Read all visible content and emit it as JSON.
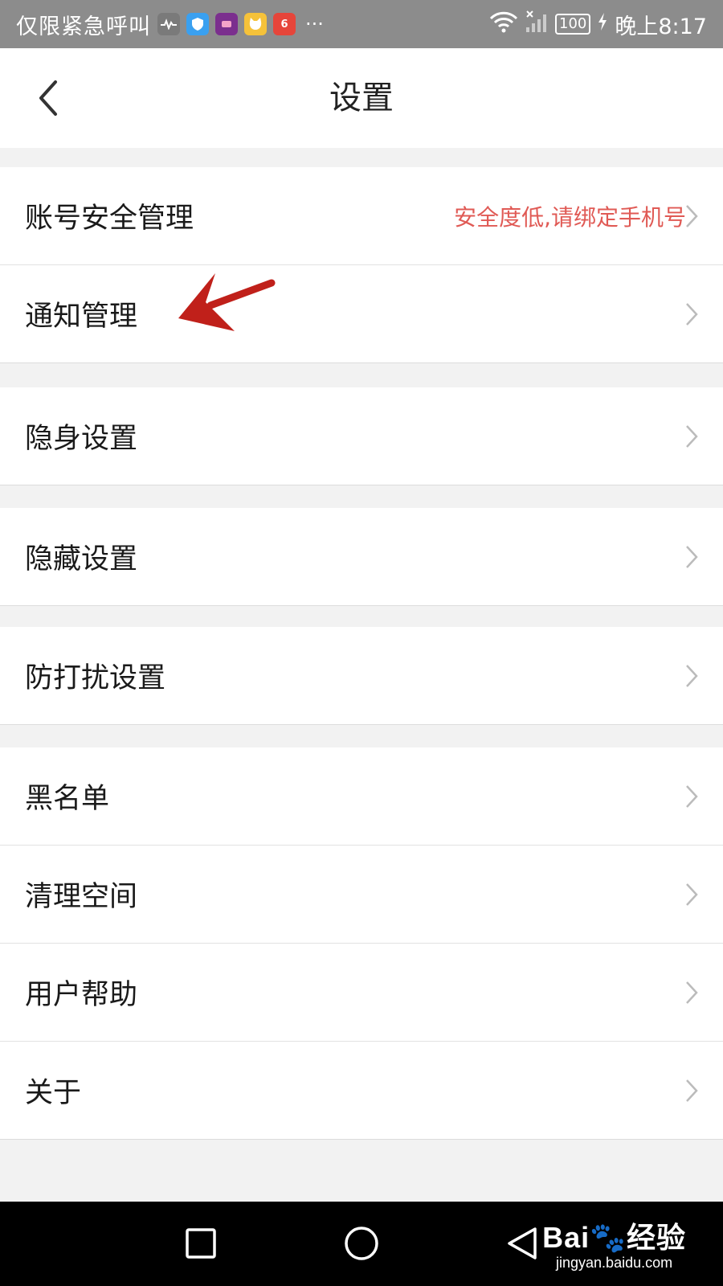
{
  "status_bar": {
    "carrier": "仅限紧急呼叫",
    "battery": "100",
    "time": "晚上8:17",
    "app_icons": [
      {
        "name": "activity-monitor-icon",
        "color": "#7a7a7a"
      },
      {
        "name": "shield-app-icon",
        "color": "#3aa0f0"
      },
      {
        "name": "music-app-icon",
        "color": "#7b2f8e"
      },
      {
        "name": "cat-app-icon",
        "color": "#f5c23a"
      },
      {
        "name": "six-app-icon",
        "color": "#e6453a",
        "text": "6"
      }
    ],
    "more": "···"
  },
  "header": {
    "title": "设置",
    "back_icon": "chevron-left-icon"
  },
  "settings": {
    "group1": [
      {
        "label": "账号安全管理",
        "hint": "安全度低,请绑定手机号"
      },
      {
        "label": "通知管理"
      }
    ],
    "group2": [
      {
        "label": "隐身设置"
      }
    ],
    "group3": [
      {
        "label": "隐藏设置"
      }
    ],
    "group4": [
      {
        "label": "防打扰设置"
      }
    ],
    "group5": [
      {
        "label": "黑名单"
      },
      {
        "label": "清理空间"
      },
      {
        "label": "用户帮助"
      },
      {
        "label": "关于"
      }
    ]
  },
  "colors": {
    "hint": "#e05a55",
    "annotation_arrow": "#c0201a",
    "page_bg": "#f2f2f2",
    "status_bar_bg": "#8c8c8c"
  },
  "watermark": {
    "logo": "Bai🐾经验",
    "url": "jingyan.baidu.com"
  }
}
